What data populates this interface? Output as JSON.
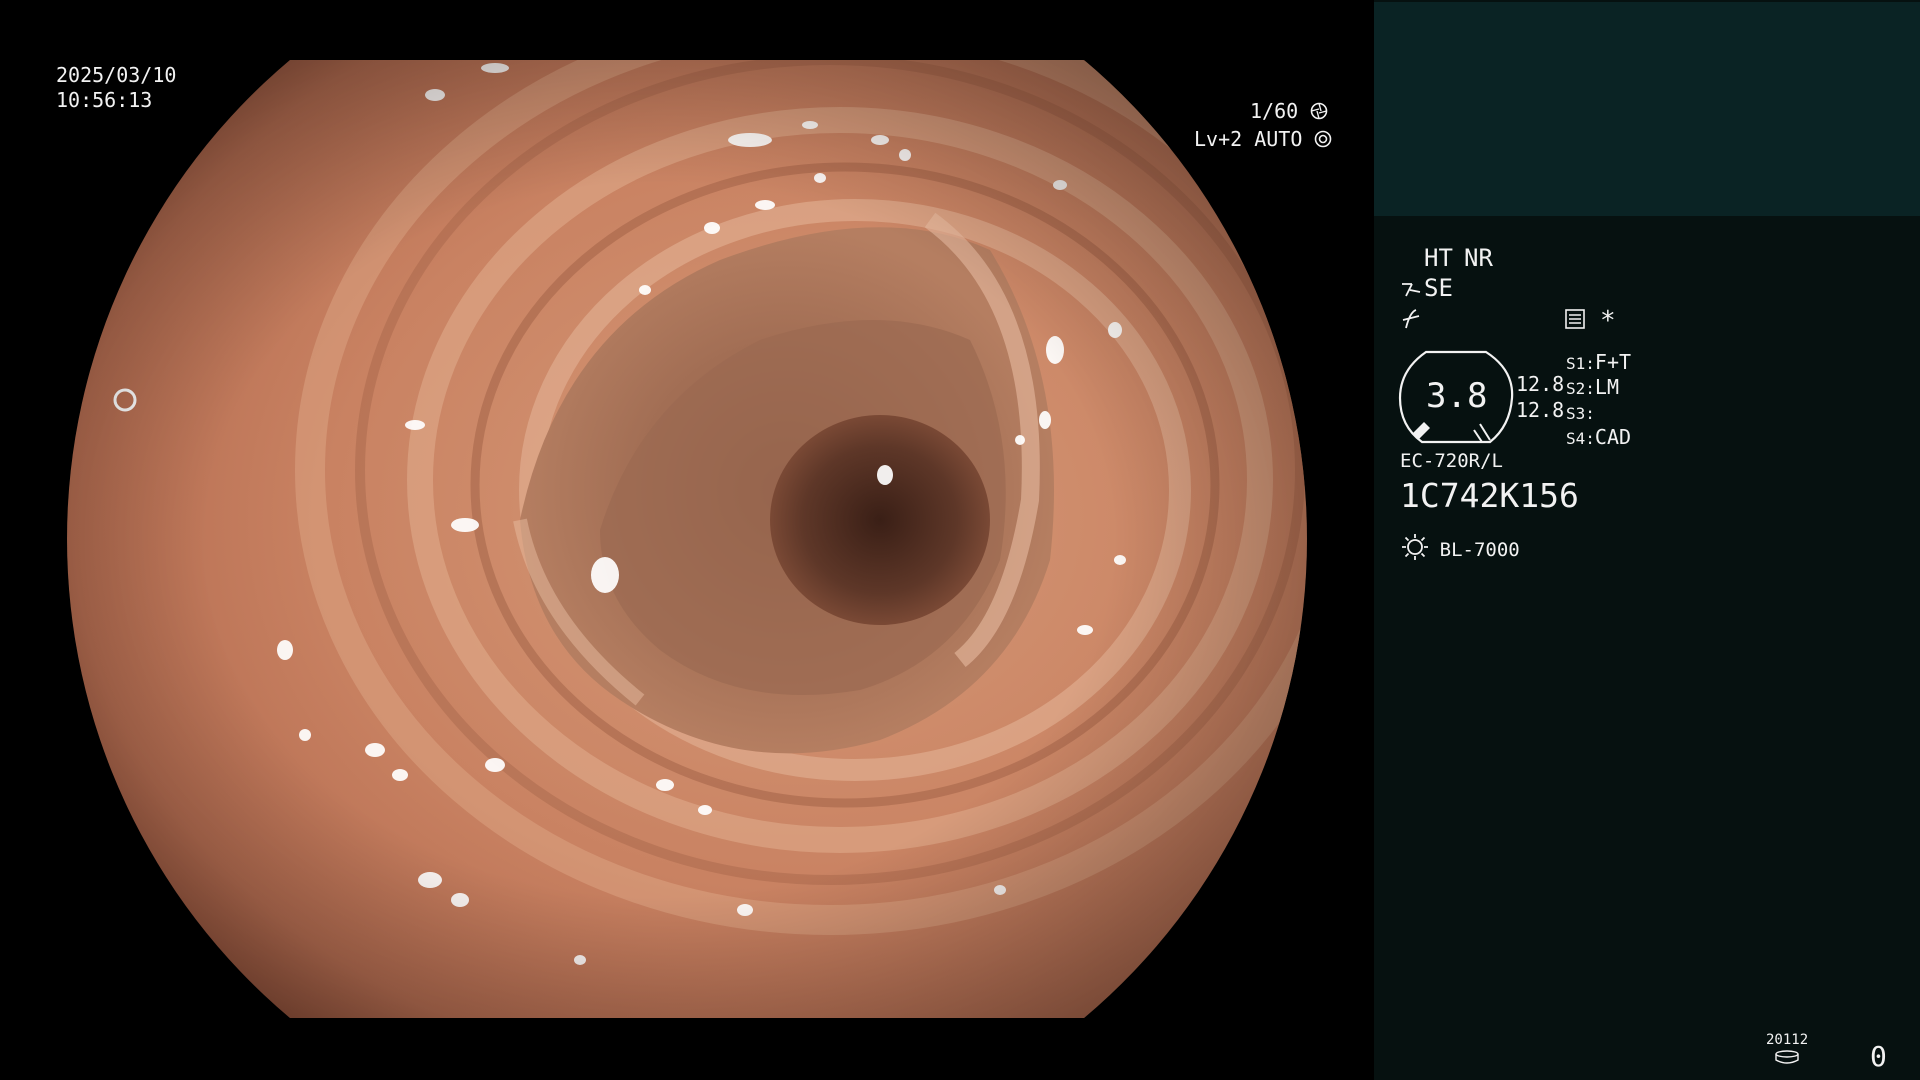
{
  "osd": {
    "date": "2025/03/10",
    "time": "10:56:13",
    "shutter": "1/60",
    "level": "Lv+2",
    "mode": "AUTO"
  },
  "panel": {
    "ht": "HT",
    "nr": "NR",
    "se": "SE",
    "asterisk": "*",
    "zoom_value": "3.8",
    "aperture_top": "12.8",
    "aperture_bottom": "12.8",
    "s1_key": "S1:",
    "s1_value": "F+T",
    "s2_key": "S2:",
    "s2_value": "LM",
    "s3_key": "S3:",
    "s3_value": "",
    "s4_key": "S4:",
    "s4_value": "CAD",
    "scope_model": "EC-720R/L",
    "serial": "1C742K156",
    "light_source": "BL-7000",
    "counter_label": "20112",
    "counter_value": "0"
  },
  "colors": {
    "panel_bg": "#061110",
    "panel_top": "#0a2324",
    "label_orange": "#f0a63c",
    "text": "#f2f2f2"
  },
  "icons": [
    "shutter-icon",
    "auto-iris-icon",
    "se-enhance-icon",
    "noise-curve-icon",
    "record-icon",
    "zoom-gauge-icon",
    "light-source-icon",
    "storage-icon"
  ]
}
